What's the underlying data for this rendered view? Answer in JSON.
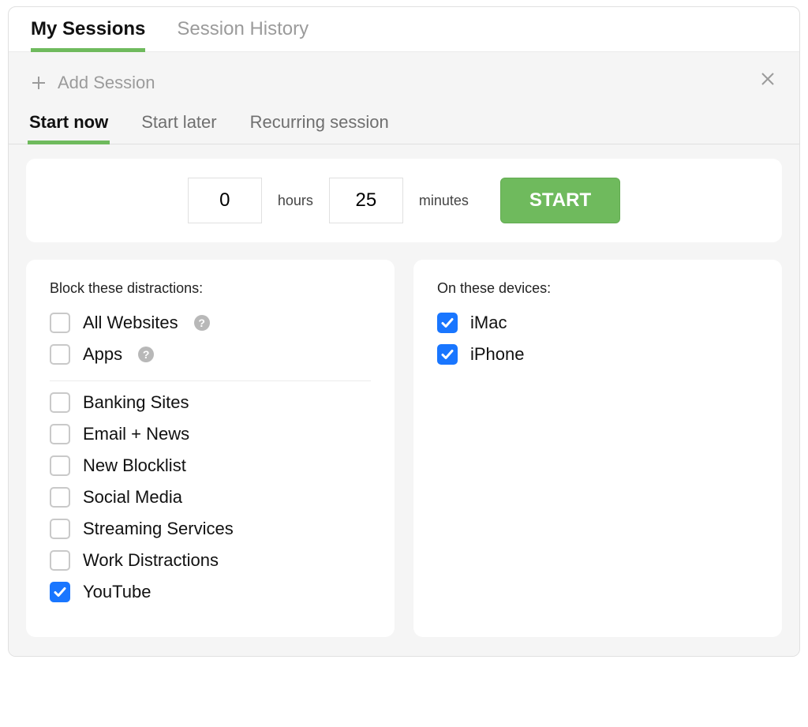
{
  "top_tabs": {
    "my_sessions": "My Sessions",
    "session_history": "Session History"
  },
  "add_session_label": "Add Session",
  "sub_tabs": {
    "start_now": "Start now",
    "start_later": "Start later",
    "recurring": "Recurring session"
  },
  "time": {
    "hours": "0",
    "hours_label": "hours",
    "minutes": "25",
    "minutes_label": "minutes",
    "start_button": "START"
  },
  "block_card_title": "Block these distractions:",
  "block_items_top": [
    {
      "label": "All Websites",
      "checked": false,
      "help": true
    },
    {
      "label": "Apps",
      "checked": false,
      "help": true
    }
  ],
  "block_items": [
    {
      "label": "Banking Sites",
      "checked": false
    },
    {
      "label": "Email + News",
      "checked": false
    },
    {
      "label": "New Blocklist",
      "checked": false
    },
    {
      "label": "Social Media",
      "checked": false
    },
    {
      "label": "Streaming Services",
      "checked": false
    },
    {
      "label": "Work Distractions",
      "checked": false
    },
    {
      "label": "YouTube",
      "checked": true
    }
  ],
  "devices_card_title": "On these devices:",
  "devices": [
    {
      "label": "iMac",
      "checked": true
    },
    {
      "label": "iPhone",
      "checked": true
    }
  ]
}
